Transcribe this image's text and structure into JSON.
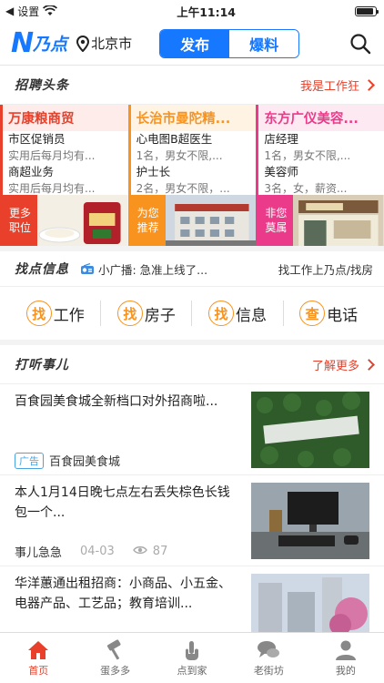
{
  "status": {
    "carrier": "设置",
    "time": "上午11:14"
  },
  "nav": {
    "logo": "乃点",
    "city": "北京市",
    "seg_post": "发布",
    "seg_news": "爆料"
  },
  "jobs": {
    "title": "招聘头条",
    "more": "我是工作狂",
    "cards": [
      {
        "company": "万康粮商贸",
        "job1": "市区促销员",
        "meta1": "实用后每月均有...",
        "job2": "商超业务",
        "meta2": "实用后每月均有...",
        "tag1": "更多",
        "tag2": "职位"
      },
      {
        "company": "长治市曼陀精...",
        "job1": "心电图B超医生",
        "meta1": "1名，男女不限,...",
        "job2": "护士长",
        "meta2": "2名，男女不限，...",
        "tag1": "为您",
        "tag2": "推荐"
      },
      {
        "company": "东方广仪美容...",
        "job1": "店经理",
        "meta1": "1名，男女不限,...",
        "job2": "美容师",
        "meta2": "3名，女，薪资...",
        "tag1": "非您",
        "tag2": "莫属"
      }
    ]
  },
  "info": {
    "title": "找点信息",
    "broadcast": "小广播: 急准上线了...",
    "right": "找工作上乃点/找房"
  },
  "quick": [
    {
      "badge": "找",
      "label": "工作"
    },
    {
      "badge": "找",
      "label": "房子"
    },
    {
      "badge": "找",
      "label": "信息"
    },
    {
      "badge": "查",
      "label": "电话"
    }
  ],
  "news": {
    "title": "打听事儿",
    "more": "了解更多",
    "items": [
      {
        "title": "百食园美食城全新档口对外招商啦...",
        "ad": "广告",
        "source": "百食园美食城"
      },
      {
        "title": "本人1月14日晚七点左右丢失棕色长钱包一个...",
        "source": "事儿急急",
        "date": "04-03",
        "views": "87"
      },
      {
        "title": "华洋蕙通出租招商：小商品、小五金、电器产品、工艺品；教育培训...",
        "source": ""
      }
    ]
  },
  "tabs": [
    "首页",
    "蛋多多",
    "点到家",
    "老街坊",
    "我的"
  ]
}
